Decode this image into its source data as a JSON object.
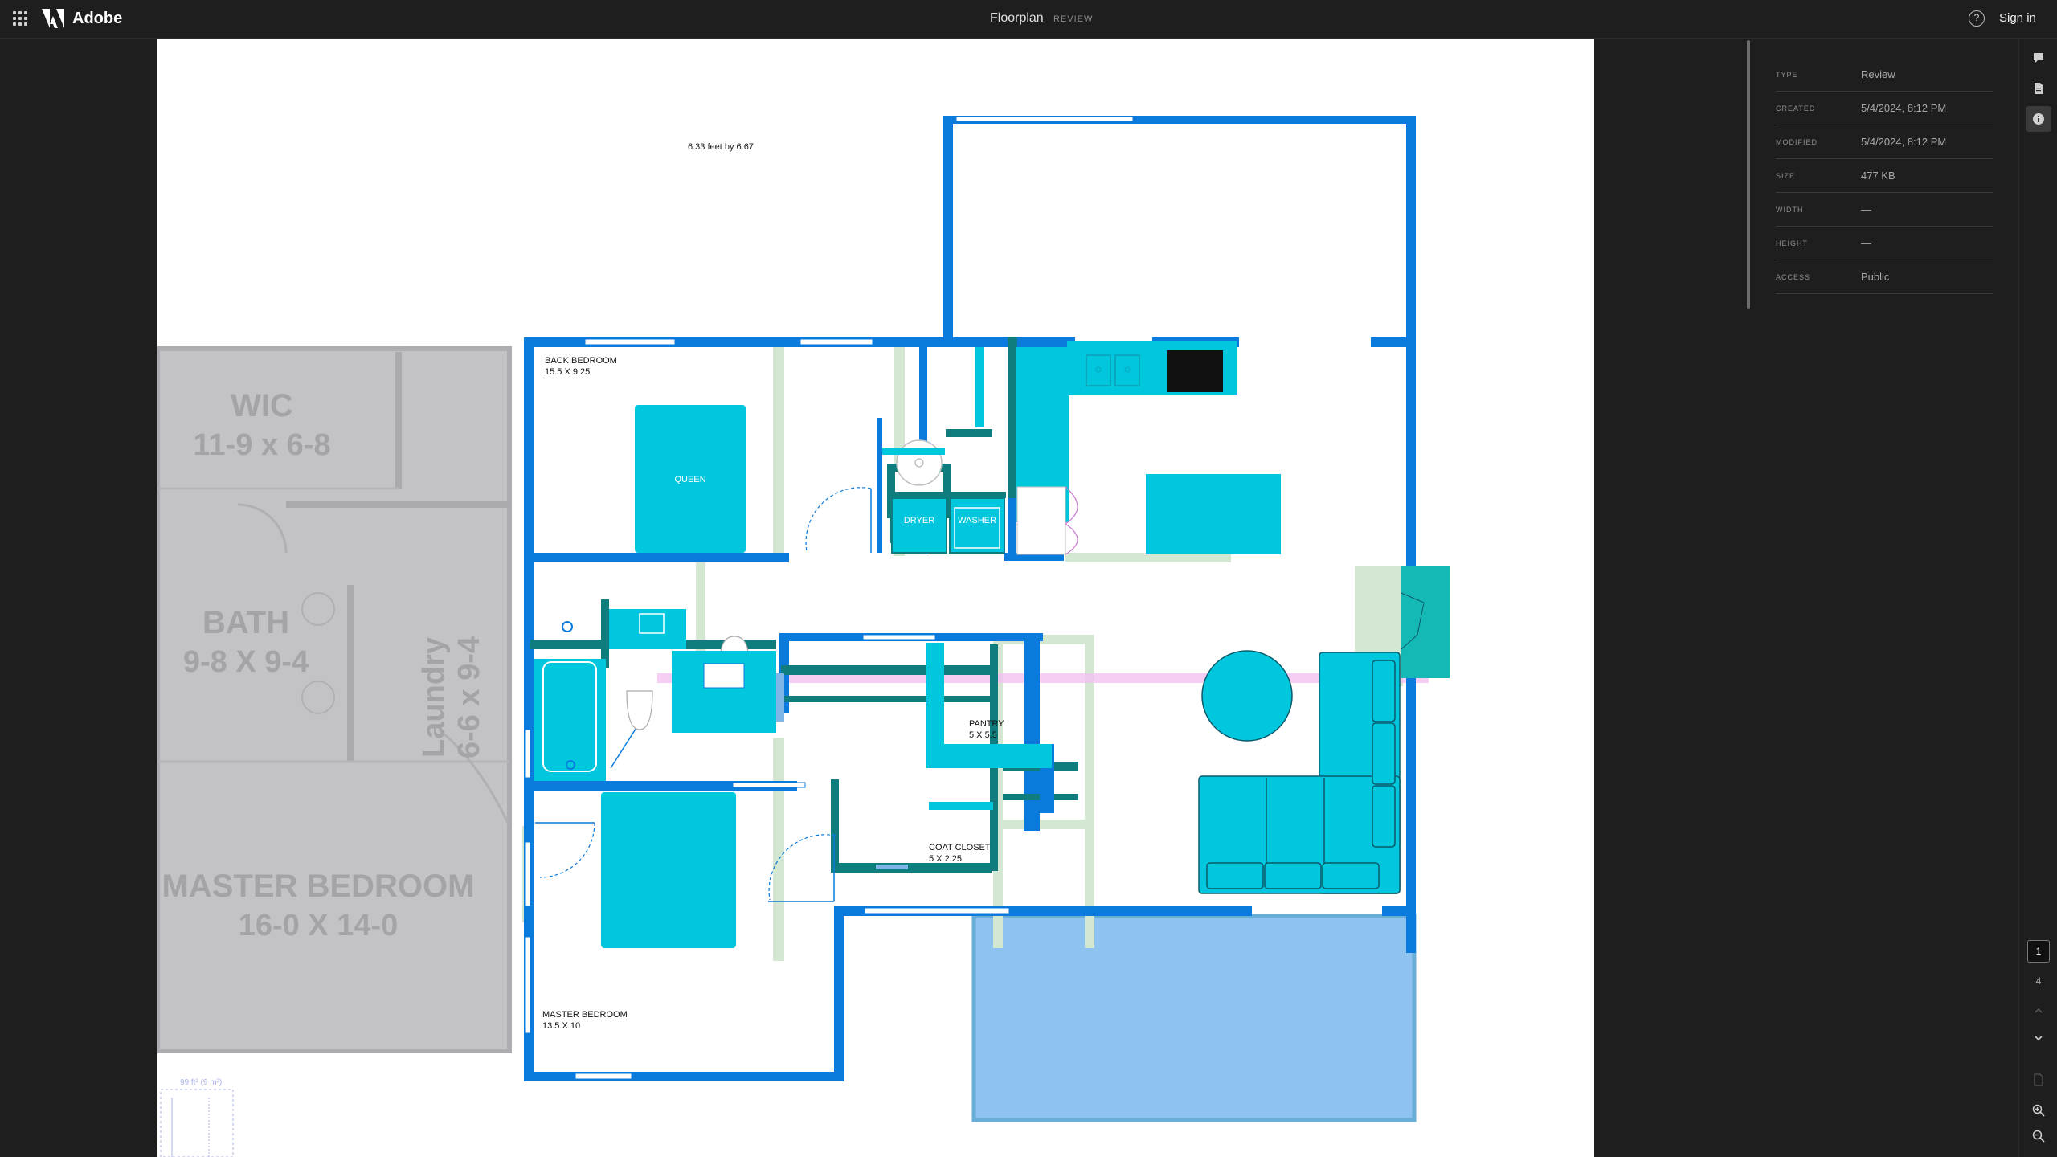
{
  "header": {
    "brand": "Adobe",
    "doc_title": "Floorplan",
    "doc_badge": "REVIEW",
    "signin": "Sign in"
  },
  "plan": {
    "dimension_note": "6.33 feet by 6.67",
    "rooms": {
      "back_bedroom_name": "BACK BEDROOM",
      "back_bedroom_size": "15.5 X 9.25",
      "bed_queen": "QUEEN",
      "dryer": "DRYER",
      "washer": "WASHER",
      "pantry_name": "PANTRY",
      "pantry_size": "5 X 5.5",
      "coat_name": "COAT CLOSET",
      "coat_size": "5 X 2.25",
      "master_name": "MASTER BEDROOM",
      "master_size": "13.5 X 10"
    },
    "underlay": {
      "wic_name": "WIC",
      "wic_size": "11-9 x 6-8",
      "bath_name": "BATH",
      "bath_size": "9-8 X 9-4",
      "laundry_name": "Laundry",
      "laundry_size": "6-6 x 9-4",
      "master_name": "MASTER BEDROOM",
      "master_size": "16-0 X 14-0"
    },
    "legend_area": "99 ft² (9 m²)"
  },
  "info": {
    "rows": [
      {
        "key": "TYPE",
        "value": "Review"
      },
      {
        "key": "CREATED",
        "value": "5/4/2024, 8:12 PM"
      },
      {
        "key": "MODIFIED",
        "value": "5/4/2024, 8:12 PM"
      },
      {
        "key": "SIZE",
        "value": "477 KB"
      },
      {
        "key": "WIDTH",
        "value": "—"
      },
      {
        "key": "HEIGHT",
        "value": "—"
      },
      {
        "key": "ACCESS",
        "value": "Public"
      }
    ]
  },
  "pager": {
    "current": "1",
    "total": "4"
  },
  "colors": {
    "wall": "#0a7bdc",
    "furniture": "#00c7de",
    "teal": "#0f7d7d",
    "ghost": "#c7dfc7",
    "patio": "#8ec3f0"
  },
  "icons": [
    "app-switcher-icon",
    "adobe-logo-icon",
    "help-icon",
    "comment-icon",
    "file-icon",
    "info-icon",
    "chevron-up-icon",
    "chevron-down-icon",
    "zoom-in-icon",
    "zoom-out-icon"
  ]
}
